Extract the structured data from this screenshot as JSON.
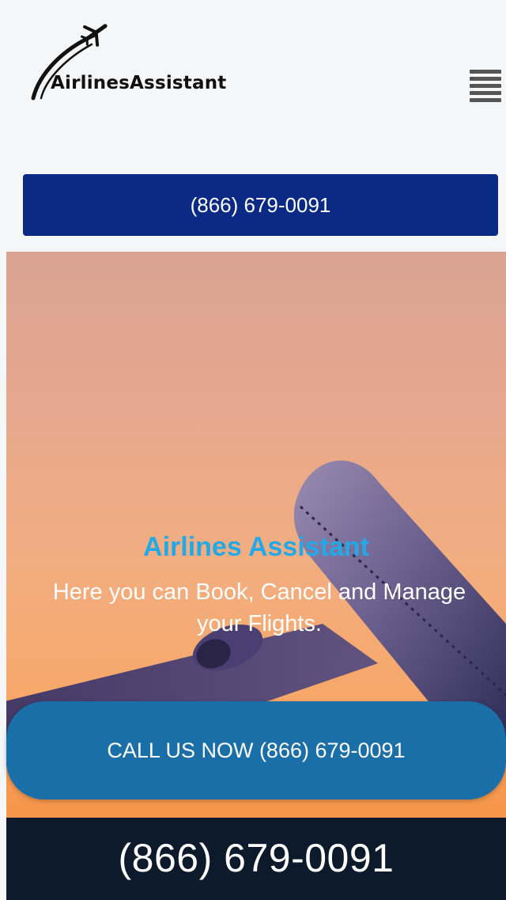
{
  "header": {
    "brand": "AirlinesAssistant",
    "menu_icon": "hamburger-menu-icon"
  },
  "call_bar": {
    "label": "(866) 679-0091"
  },
  "hero": {
    "title": "Airlines Assistant",
    "subtitle": "Here you can Book, Cancel and Manage your Flights."
  },
  "cta": {
    "label": "CALL US NOW (866) 679-0091"
  },
  "footer": {
    "phone": "(866) 679-0091"
  },
  "colors": {
    "call_bar": "#0a2a86",
    "cta": "#1b6fa9",
    "hero_title": "#22a9e6",
    "footer_bg": "#0d1a2c"
  }
}
